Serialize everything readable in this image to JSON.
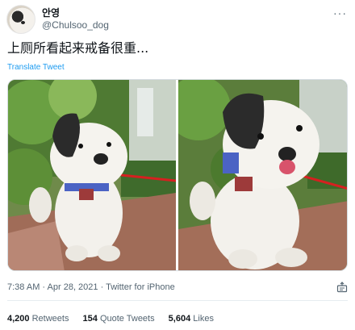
{
  "author": {
    "display_name": "안영",
    "handle": "@Chulsoo_dog"
  },
  "more_label": "···",
  "tweet": {
    "text": "上厕所看起来戒备很重...",
    "translate_label": "Translate Tweet"
  },
  "media": {
    "photos": [
      {
        "subject": "dog-photo-left"
      },
      {
        "subject": "dog-photo-right"
      }
    ]
  },
  "meta": {
    "time": "7:38 AM",
    "separator": " · ",
    "date": "Apr 28, 2021",
    "source": "Twitter for iPhone"
  },
  "stats": {
    "retweets_count": "4,200",
    "retweets_label": "Retweets",
    "quote_count": "154",
    "quote_label": "Quote Tweets",
    "likes_count": "5,604",
    "likes_label": "Likes"
  },
  "colors": {
    "link": "#1d9bf0",
    "text": "#0f1419",
    "secondary": "#536471"
  },
  "icons": {
    "more": "more-horizontal-icon",
    "share": "share-icon"
  }
}
